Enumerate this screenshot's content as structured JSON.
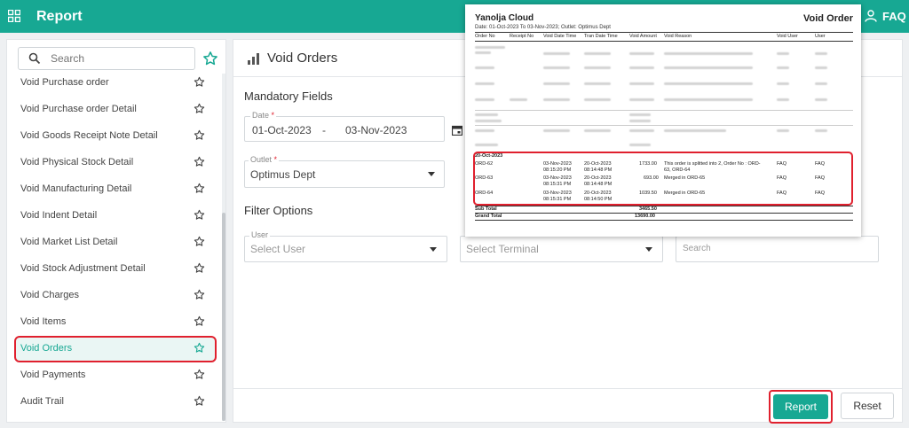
{
  "header": {
    "title": "Report",
    "user_label": "FAQ"
  },
  "sidebar": {
    "search_placeholder": "Search",
    "items": [
      {
        "label": "Void Purchase order",
        "active": false
      },
      {
        "label": "Void Purchase order Detail",
        "active": false
      },
      {
        "label": "Void Goods Receipt Note Detail",
        "active": false
      },
      {
        "label": "Void Physical Stock Detail",
        "active": false
      },
      {
        "label": "Void Manufacturing Detail",
        "active": false
      },
      {
        "label": "Void Indent Detail",
        "active": false
      },
      {
        "label": "Void Market List Detail",
        "active": false
      },
      {
        "label": "Void Stock Adjustment Detail",
        "active": false
      },
      {
        "label": "Void Charges",
        "active": false
      },
      {
        "label": "Void Items",
        "active": false
      },
      {
        "label": "Void Orders",
        "active": true
      },
      {
        "label": "Void Payments",
        "active": false
      },
      {
        "label": "Audit Trail",
        "active": false
      }
    ]
  },
  "main": {
    "title": "Void Orders",
    "mandatory_title": "Mandatory Fields",
    "date_label": "Date",
    "date_from": "01-Oct-2023",
    "date_sep": "-",
    "date_to": "03-Nov-2023",
    "outlet_label": "Outlet",
    "outlet_value": "Optimus Dept",
    "filter_title": "Filter Options",
    "user_label": "User",
    "user_placeholder": "Select User",
    "terminal_placeholder": "Select Terminal",
    "search_placeholder": "Search",
    "report_button": "Report",
    "reset_button": "Reset"
  },
  "preview": {
    "company": "Yanolja Cloud",
    "title": "Void Order",
    "subtitle": "Date: 01-Oct-2023 To 03-Nov-2023; Outlet: Optimus Dept",
    "columns": [
      "Order No",
      "Receipt No",
      "Void Date Time",
      "Tran Date Time",
      "Void Amount",
      "Void Reason",
      "Void User",
      "User"
    ],
    "group_date": "20-Oct-2023",
    "rows": [
      {
        "order_no": "ORD-62",
        "void_date": "03-Nov-2023",
        "void_time": "08:15:20 PM",
        "tran_date": "20-Oct-2023",
        "tran_time": "08:14:48 PM",
        "amount": "1733.00",
        "reason_1": "This order is splitted into 2, Order No : ORD-",
        "reason_2": "63, ORD-64",
        "void_user": "FAQ",
        "user": "FAQ"
      },
      {
        "order_no": "ORD-63",
        "void_date": "03-Nov-2023",
        "void_time": "08:15:31 PM",
        "tran_date": "20-Oct-2023",
        "tran_time": "08:14:48 PM",
        "amount": "693.00",
        "reason_1": "Merged in ORD-65",
        "reason_2": "",
        "void_user": "FAQ",
        "user": "FAQ"
      },
      {
        "order_no": "ORD-64",
        "void_date": "03-Nov-2023",
        "void_time": "08:15:31 PM",
        "tran_date": "20-Oct-2023",
        "tran_time": "08:14:50 PM",
        "amount": "1039.50",
        "reason_1": "Merged in ORD-65",
        "reason_2": "",
        "void_user": "FAQ",
        "user": "FAQ"
      }
    ],
    "sub_total_label": "Sub Total",
    "sub_total_value": "3465.50",
    "grand_total_label": "Grand Total",
    "grand_total_value": "13690.00"
  }
}
